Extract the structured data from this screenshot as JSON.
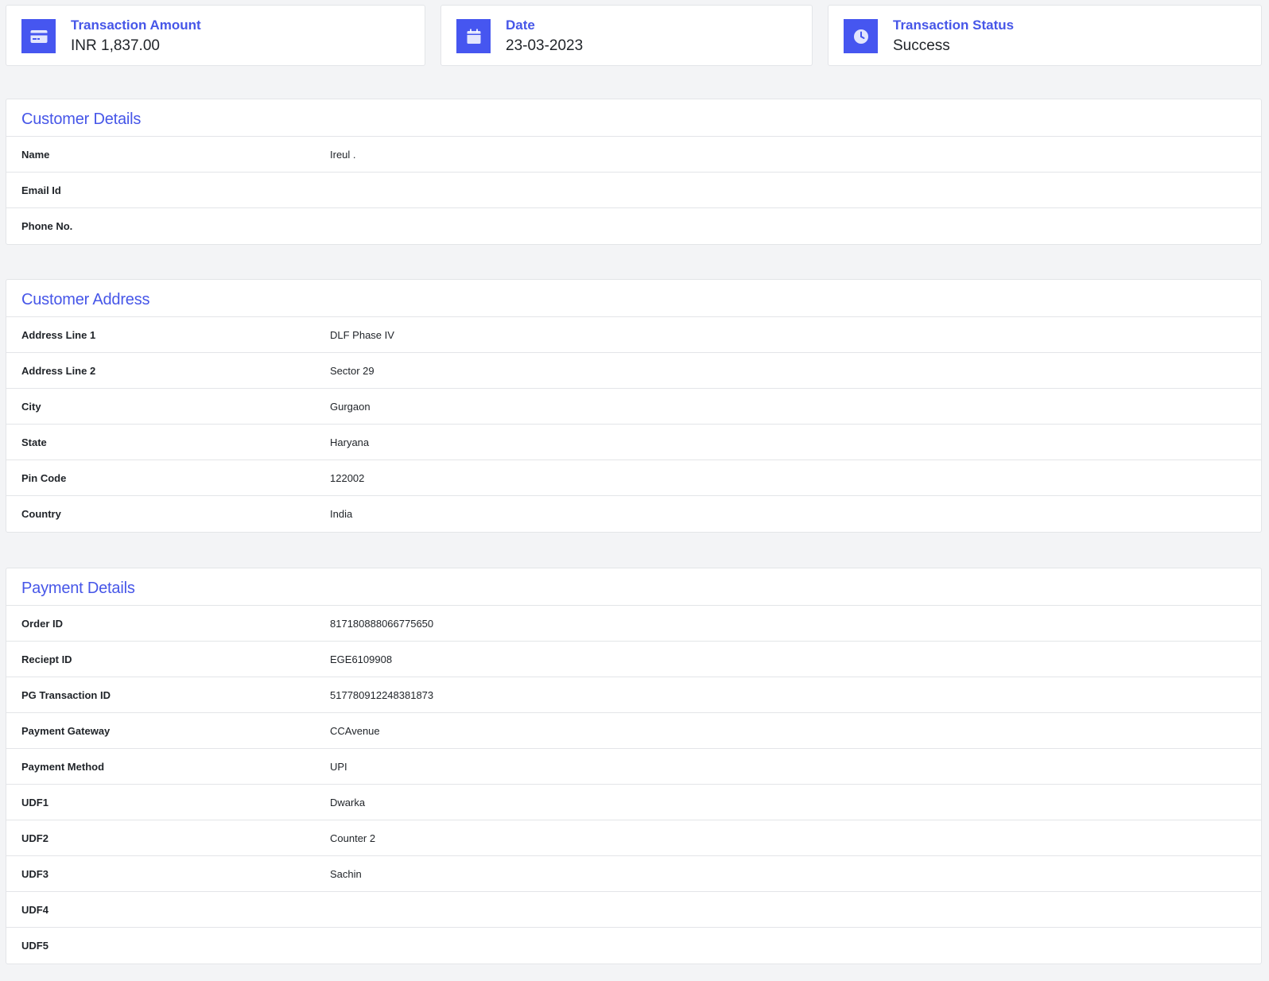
{
  "stats": {
    "amount": {
      "label": "Transaction Amount",
      "value": "INR 1,837.00",
      "icon": "credit-card-icon"
    },
    "date": {
      "label": "Date",
      "value": "23-03-2023",
      "icon": "calendar-icon"
    },
    "status": {
      "label": "Transaction Status",
      "value": "Success",
      "icon": "clock-icon"
    }
  },
  "customer_details": {
    "title": "Customer Details",
    "rows": [
      {
        "label": "Name",
        "value": "Ireul ."
      },
      {
        "label": "Email Id",
        "value": ""
      },
      {
        "label": "Phone No.",
        "value": ""
      }
    ]
  },
  "customer_address": {
    "title": "Customer Address",
    "rows": [
      {
        "label": "Address Line 1",
        "value": "DLF Phase IV"
      },
      {
        "label": "Address Line 2",
        "value": "Sector 29"
      },
      {
        "label": "City",
        "value": "Gurgaon"
      },
      {
        "label": "State",
        "value": "Haryana"
      },
      {
        "label": "Pin Code",
        "value": "122002"
      },
      {
        "label": "Country",
        "value": "India"
      }
    ]
  },
  "payment_details": {
    "title": "Payment Details",
    "rows": [
      {
        "label": "Order ID",
        "value": "817180888066775650"
      },
      {
        "label": "Reciept ID",
        "value": "EGE6109908"
      },
      {
        "label": "PG Transaction ID",
        "value": "517780912248381873"
      },
      {
        "label": "Payment Gateway",
        "value": "CCAvenue"
      },
      {
        "label": "Payment Method",
        "value": "UPI"
      },
      {
        "label": "UDF1",
        "value": "Dwarka"
      },
      {
        "label": "UDF2",
        "value": "Counter 2"
      },
      {
        "label": "UDF3",
        "value": "Sachin"
      },
      {
        "label": "UDF4",
        "value": ""
      },
      {
        "label": "UDF5",
        "value": ""
      }
    ]
  },
  "colors": {
    "accent": "#4656f0",
    "page_bg": "#f3f4f6",
    "border": "#e3e5e8"
  }
}
